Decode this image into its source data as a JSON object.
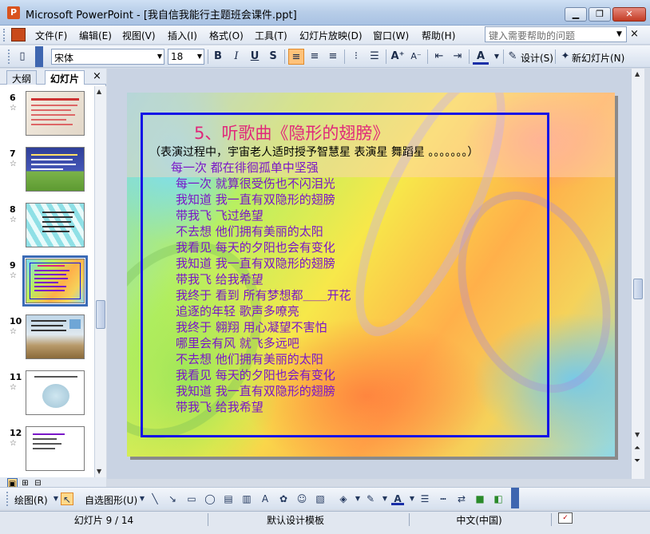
{
  "window": {
    "title": "Microsoft PowerPoint - [我自信我能行主题班会课件.ppt]",
    "app_icon": "powerpoint-icon",
    "min_label": "▁",
    "max_label": "❐",
    "close_label": "✕"
  },
  "menubar": {
    "items": [
      "文件(F)",
      "编辑(E)",
      "视图(V)",
      "插入(I)",
      "格式(O)",
      "工具(T)",
      "幻灯片放映(D)",
      "窗口(W)",
      "帮助(H)"
    ],
    "help_placeholder": "键入需要帮助的问题",
    "close_label": "×"
  },
  "toolbar": {
    "font_name": "宋体",
    "font_size": "18",
    "bold": "B",
    "italic": "I",
    "underline": "U",
    "shadow": "S",
    "align_left_active": true,
    "design_label": "设计(S)",
    "new_slide_label": "新幻灯片(N)"
  },
  "left_pane": {
    "tabs": [
      "大纲",
      "幻灯片"
    ],
    "selected_tab": "幻灯片",
    "close_label": "×",
    "slides": [
      {
        "num": "6",
        "star": "☆"
      },
      {
        "num": "7",
        "star": "☆"
      },
      {
        "num": "8",
        "star": "☆"
      },
      {
        "num": "9",
        "star": "☆",
        "current": true
      },
      {
        "num": "10",
        "star": "☆"
      },
      {
        "num": "11",
        "star": "☆"
      },
      {
        "num": "12",
        "star": "☆"
      }
    ]
  },
  "slide": {
    "title": "5、听歌曲《隐形的翅膀》",
    "note": "（表演过程中，宇宙老人适时授予智慧星 表演星 舞蹈星 。。。。。。。）",
    "lyrics": [
      "每一次 都在徘徊孤单中坚强",
      "每一次 就算很受伤也不闪泪光",
      "我知道 我一直有双隐形的翅膀",
      "带我飞 飞过绝望",
      "不去想 他们拥有美丽的太阳",
      "我看见 每天的夕阳也会有变化",
      "我知道 我一直有双隐形的翅膀",
      "带我飞 给我希望",
      "我终于 看到 所有梦想都＿＿开花",
      "追逐的年轻 歌声多嘹亮",
      "我终于 翱翔 用心凝望不害怕",
      "哪里会有风 就飞多远吧",
      "不去想 他们拥有美丽的太阳",
      "我看见 每天的夕阳也会有变化",
      "我知道 我一直有双隐形的翅膀",
      "带我飞 给我希望"
    ],
    "title_color": "#e0287a",
    "lyric_color": "#7a16c8",
    "frame_color": "#1414e6"
  },
  "drawbar": {
    "draw_label": "绘图(R)",
    "autoshape_label": "自选图形(U)"
  },
  "statusbar": {
    "slide_info": "幻灯片 9 / 14",
    "template": "默认设计模板",
    "language": "中文(中国)"
  }
}
